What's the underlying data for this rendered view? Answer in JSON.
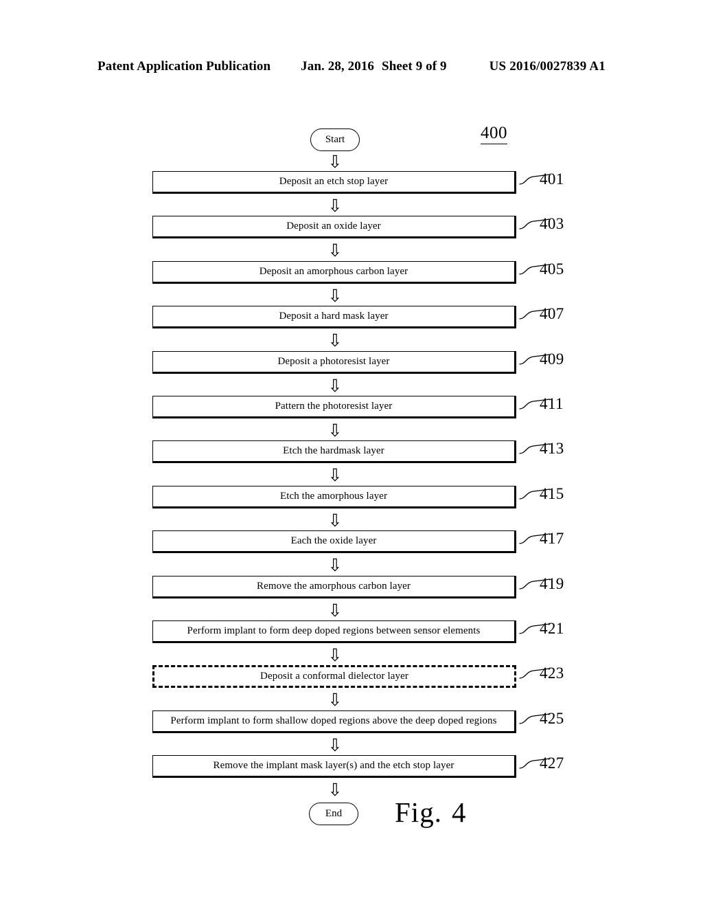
{
  "header": {
    "publication": "Patent Application Publication",
    "date": "Jan. 28, 2016",
    "sheet": "Sheet 9 of 9",
    "patent_number": "US 2016/0027839 A1"
  },
  "figure": {
    "flow_label": "400",
    "caption_prefix": "Fig.",
    "caption_number": "4",
    "start_label": "Start",
    "end_label": "End",
    "arrow_glyph": "⇩",
    "steps": [
      {
        "ref": "401",
        "text": "Deposit an etch stop layer",
        "style": "solid"
      },
      {
        "ref": "403",
        "text": "Deposit an oxide layer",
        "style": "solid"
      },
      {
        "ref": "405",
        "text": "Deposit an amorphous carbon layer",
        "style": "solid"
      },
      {
        "ref": "407",
        "text": "Deposit a hard mask layer",
        "style": "solid"
      },
      {
        "ref": "409",
        "text": "Deposit a photoresist layer",
        "style": "solid"
      },
      {
        "ref": "411",
        "text": "Pattern the photoresist layer",
        "style": "solid"
      },
      {
        "ref": "413",
        "text": "Etch the hardmask layer",
        "style": "solid"
      },
      {
        "ref": "415",
        "text": "Etch the amorphous layer",
        "style": "solid"
      },
      {
        "ref": "417",
        "text": "Each the oxide layer",
        "style": "solid"
      },
      {
        "ref": "419",
        "text": "Remove the amorphous carbon layer",
        "style": "solid"
      },
      {
        "ref": "421",
        "text": "Perform implant to form deep doped regions between sensor elements",
        "style": "solid"
      },
      {
        "ref": "423",
        "text": "Deposit a conformal dielector layer",
        "style": "dashed"
      },
      {
        "ref": "425",
        "text": "Perform implant to form shallow doped regions above the deep doped regions",
        "style": "solid"
      },
      {
        "ref": "427",
        "text": "Remove the implant mask layer(s) and the etch stop layer",
        "style": "solid"
      }
    ]
  },
  "colors": {
    "ink": "#000000",
    "paper": "#ffffff"
  }
}
